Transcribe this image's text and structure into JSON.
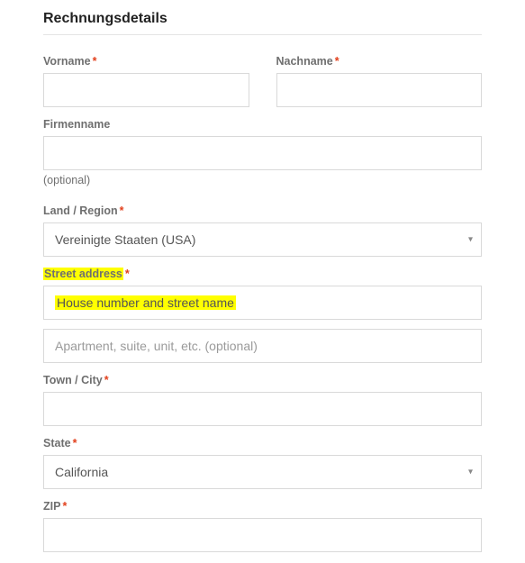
{
  "section_title": "Rechnungsdetails",
  "required_marker": "*",
  "fields": {
    "first_name": {
      "label": "Vorname",
      "value": ""
    },
    "last_name": {
      "label": "Nachname",
      "value": ""
    },
    "company": {
      "label": "Firmenname",
      "value": "",
      "optional_note": "(optional)"
    },
    "country": {
      "label": "Land / Region",
      "selected": "Vereinigte Staaten (USA)"
    },
    "street": {
      "label": "Street address",
      "line1_placeholder": "House number and street name",
      "line2_placeholder": "Apartment, suite, unit, etc. (optional)",
      "line1_value": "",
      "line2_value": ""
    },
    "city": {
      "label": "Town / City",
      "value": ""
    },
    "state": {
      "label": "State",
      "selected": "California"
    },
    "zip": {
      "label": "ZIP",
      "value": ""
    }
  },
  "caret_glyph": "▾"
}
